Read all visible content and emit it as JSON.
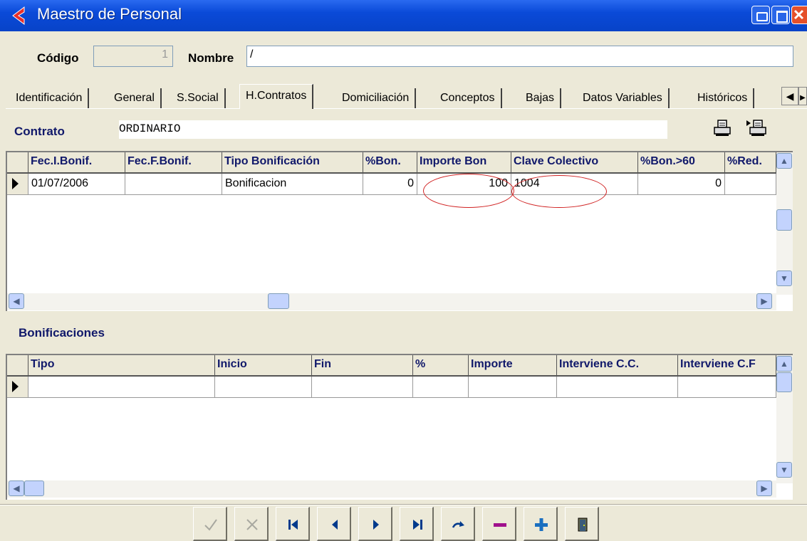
{
  "window": {
    "title": "Maestro de Personal"
  },
  "header": {
    "codigo_label": "Código",
    "codigo_value": "1",
    "nombre_label": "Nombre",
    "nombre_value": "/"
  },
  "tabs": [
    {
      "label": "Identificación",
      "active": false
    },
    {
      "label": "General",
      "active": false
    },
    {
      "label": "S.Social",
      "active": false
    },
    {
      "label": "H.Contratos",
      "active": true
    },
    {
      "label": "Domiciliación",
      "active": false
    },
    {
      "label": "Conceptos",
      "active": false
    },
    {
      "label": "Bajas",
      "active": false
    },
    {
      "label": "Datos Variables",
      "active": false
    },
    {
      "label": "Históricos",
      "active": false
    }
  ],
  "contrato": {
    "label": "Contrato",
    "value": "ORDINARIO"
  },
  "grid_contrato": {
    "headers": [
      "Fec.I.Bonif.",
      "Fec.F.Bonif.",
      "Tipo Bonificación",
      "%Bon.",
      "Importe Bon",
      "Clave Colectivo",
      "%Bon.>60",
      "%Red."
    ],
    "row": [
      "01/07/2006",
      "",
      "Bonificacion",
      "0",
      "100",
      "1004",
      "0",
      ""
    ]
  },
  "bonificaciones": {
    "label": "Bonificaciones",
    "headers": [
      "Tipo",
      "Inicio",
      "Fin",
      "%",
      "Importe",
      "Interviene C.C.",
      "Interviene C.F"
    ]
  },
  "navigator": {
    "buttons": [
      "post-check-icon",
      "cancel-x-icon",
      "first-record-icon",
      "prior-record-icon",
      "next-record-icon",
      "last-record-icon",
      "refresh-icon",
      "delete-icon",
      "insert-icon",
      "exit-door-icon"
    ]
  },
  "colors": {
    "titlebar": "#0a4ad8",
    "header_text": "#10186a",
    "annotation": "#d02020"
  }
}
